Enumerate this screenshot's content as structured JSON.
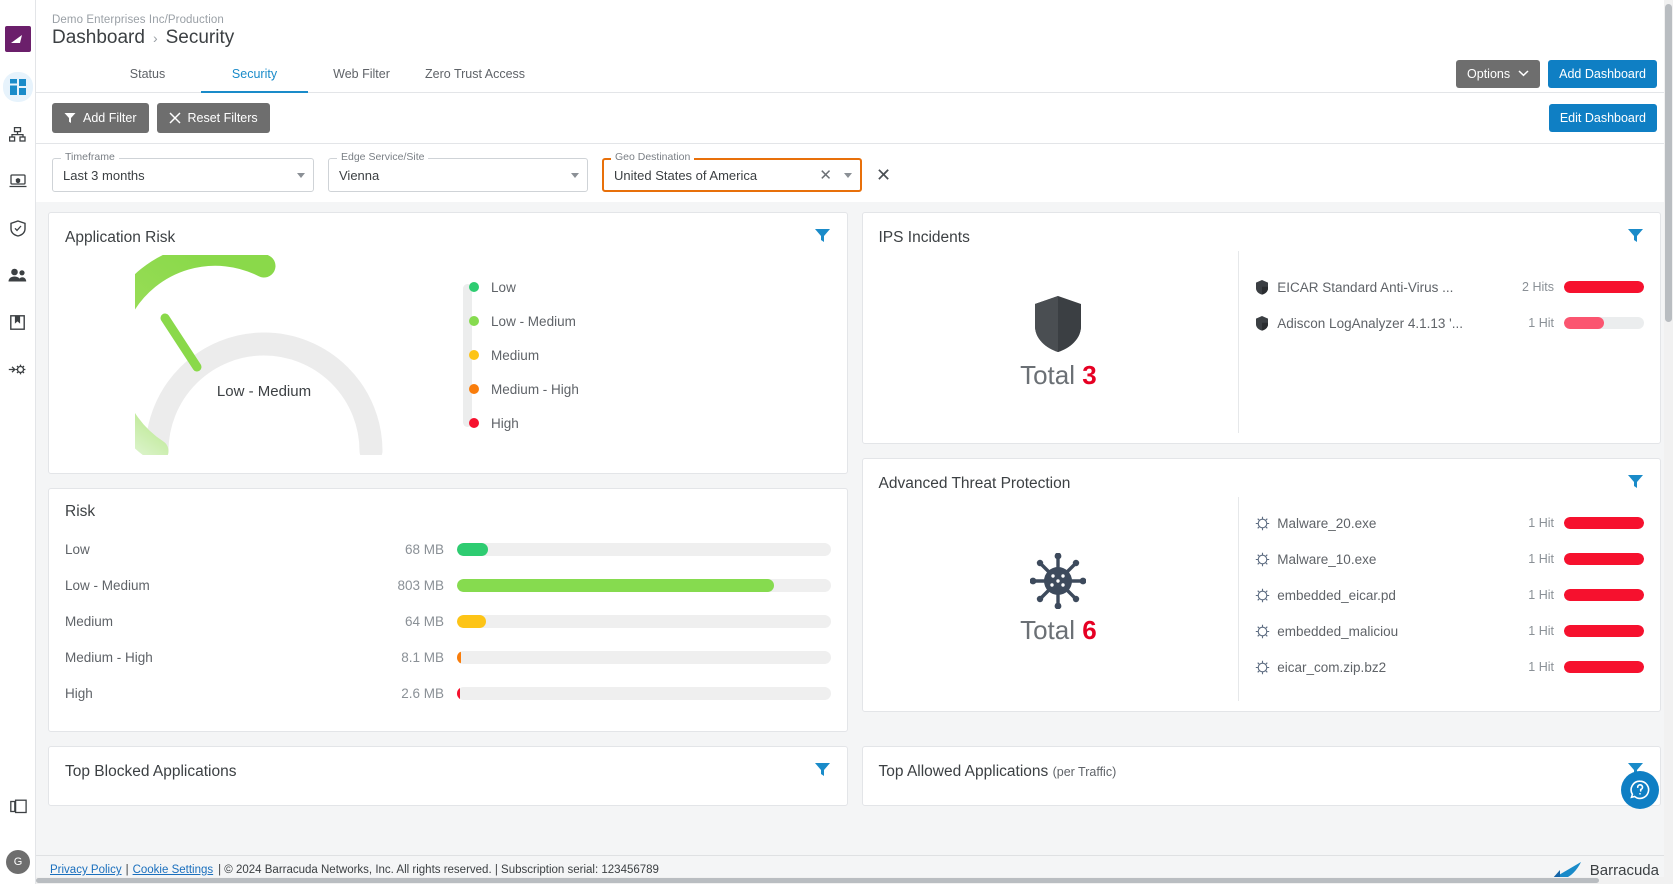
{
  "sidebar": {
    "brand_icon": "barracuda-logo-icon",
    "items": [
      {
        "name": "dashboard-icon",
        "label": "Dashboard",
        "active": true
      },
      {
        "name": "network-topology-icon",
        "label": "Network",
        "active": false
      },
      {
        "name": "endpoint-icon",
        "label": "Endpoint",
        "active": false
      },
      {
        "name": "security-shield-icon",
        "label": "Security",
        "active": false
      },
      {
        "name": "users-icon",
        "label": "Users",
        "active": false
      },
      {
        "name": "logs-book-icon",
        "label": "Logs",
        "active": false
      },
      {
        "name": "integrations-gear-icon",
        "label": "Integrations",
        "active": false
      }
    ],
    "bottom": {
      "copy_icon": "copy-stack-icon",
      "avatar_initial": "G"
    }
  },
  "header": {
    "org_breadcrumb": "Demo Enterprises Inc/Production",
    "title": "Dashboard",
    "separator": "›",
    "subtitle": "Security"
  },
  "tabs": [
    {
      "label": "Status",
      "active": false
    },
    {
      "label": "Security",
      "active": true
    },
    {
      "label": "Web Filter",
      "active": false
    },
    {
      "label": "Zero Trust Access",
      "active": false
    }
  ],
  "top_actions": {
    "options_label": "Options",
    "add_dashboard_label": "Add Dashboard",
    "edit_dashboard_label": "Edit Dashboard"
  },
  "filter_actions": {
    "add_filter_label": "Add Filter",
    "reset_filters_label": "Reset Filters"
  },
  "filters": [
    {
      "label": "Timeframe",
      "value": "Last 3 months",
      "highlighted": false,
      "clearable": false
    },
    {
      "label": "Edge Service/Site",
      "value": "Vienna",
      "highlighted": false,
      "clearable": false
    },
    {
      "label": "Geo Destination",
      "value": "United States of America",
      "highlighted": true,
      "clearable": true
    }
  ],
  "panels": {
    "application_risk": {
      "title": "Application Risk",
      "gauge_label": "Low - Medium",
      "gauge_percent": 32,
      "legend": [
        {
          "label": "Low",
          "color": "#2ecc71"
        },
        {
          "label": "Low - Medium",
          "color": "#86db4f"
        },
        {
          "label": "Medium",
          "color": "#fdc416"
        },
        {
          "label": "Medium - High",
          "color": "#f97d0b"
        },
        {
          "label": "High",
          "color": "#f6112e"
        }
      ]
    },
    "risk": {
      "title": "Risk",
      "rows": [
        {
          "label": "Low",
          "value": "68 MB",
          "color": "#2ecc71",
          "pct": 8.2
        },
        {
          "label": "Low - Medium",
          "value": "803 MB",
          "color": "#86db4f",
          "pct": 85
        },
        {
          "label": "Medium",
          "value": "64 MB",
          "color": "#fdc416",
          "pct": 7.7
        },
        {
          "label": "Medium - High",
          "value": "8.1 MB",
          "color": "#f97d0b",
          "pct": 1.2
        },
        {
          "label": "High",
          "value": "2.6 MB",
          "color": "#f6112e",
          "pct": 0.7
        }
      ]
    },
    "ips_incidents": {
      "title": "IPS Incidents",
      "icon": "shield-icon",
      "total_label": "Total",
      "total_value": "3",
      "items": [
        {
          "name": "EICAR Standard Anti-Virus ...",
          "hits": "2 Hits",
          "pct": 100,
          "color": "#f6112e"
        },
        {
          "name": "Adiscon LogAnalyzer 4.1.13 '...",
          "hits": "1 Hit",
          "pct": 50,
          "color": "#fb5570"
        }
      ]
    },
    "advanced_threat_protection": {
      "title": "Advanced Threat Protection",
      "icon": "virus-icon",
      "total_label": "Total",
      "total_value": "6",
      "items": [
        {
          "name": "Malware_20.exe",
          "hits": "1 Hit",
          "pct": 100,
          "color": "#f6112e"
        },
        {
          "name": "Malware_10.exe",
          "hits": "1 Hit",
          "pct": 100,
          "color": "#f6112e"
        },
        {
          "name": "embedded_eicar.pd",
          "hits": "1 Hit",
          "pct": 100,
          "color": "#f6112e"
        },
        {
          "name": "embedded_maliciou",
          "hits": "1 Hit",
          "pct": 100,
          "color": "#f6112e"
        },
        {
          "name": "eicar_com.zip.bz2",
          "hits": "1 Hit",
          "pct": 100,
          "color": "#f6112e"
        }
      ]
    },
    "top_blocked_applications": {
      "title": "Top Blocked Applications",
      "subtitle": ""
    },
    "top_allowed_applications": {
      "title": "Top Allowed Applications",
      "subtitle": "(per Traffic)"
    }
  },
  "help_button": {
    "icon": "question-bubble-icon",
    "label": "Help"
  },
  "footer": {
    "privacy_policy": "Privacy Policy",
    "divider1": "|",
    "cookie_settings": "Cookie Settings",
    "copyright": "| © 2024 Barracuda Networks, Inc. All rights reserved. | Subscription serial: 123456789",
    "brand": "Barracuda"
  },
  "chart_data": [
    {
      "type": "bar",
      "title": "Risk",
      "categories": [
        "Low",
        "Low - Medium",
        "Medium",
        "Medium - High",
        "High"
      ],
      "values": [
        68,
        803,
        64,
        8.1,
        2.6
      ],
      "value_labels": [
        "68 MB",
        "803 MB",
        "64 MB",
        "8.1 MB",
        "2.6 MB"
      ],
      "unit": "MB",
      "colors": [
        "#2ecc71",
        "#86db4f",
        "#fdc416",
        "#f97d0b",
        "#f6112e"
      ],
      "xlabel": "",
      "ylabel": "",
      "grid": false,
      "legend": "none"
    },
    {
      "type": "gauge",
      "title": "Application Risk",
      "value_label": "Low - Medium",
      "percent": 32,
      "scale": [
        "Low",
        "Low - Medium",
        "Medium",
        "Medium - High",
        "High"
      ]
    },
    {
      "type": "bar",
      "title": "IPS Incidents",
      "categories": [
        "EICAR Standard Anti-Virus ...",
        "Adiscon LogAnalyzer 4.1.13 '..."
      ],
      "values": [
        2,
        1
      ],
      "value_labels": [
        "2 Hits",
        "1 Hit"
      ],
      "total": 3,
      "colors": [
        "#f6112e",
        "#fb5570"
      ]
    },
    {
      "type": "bar",
      "title": "Advanced Threat Protection",
      "categories": [
        "Malware_20.exe",
        "Malware_10.exe",
        "embedded_eicar.pd",
        "embedded_maliciou",
        "eicar_com.zip.bz2"
      ],
      "values": [
        1,
        1,
        1,
        1,
        1
      ],
      "value_labels": [
        "1 Hit",
        "1 Hit",
        "1 Hit",
        "1 Hit",
        "1 Hit"
      ],
      "total": 6,
      "colors": [
        "#f6112e",
        "#f6112e",
        "#f6112e",
        "#f6112e",
        "#f6112e"
      ]
    }
  ]
}
